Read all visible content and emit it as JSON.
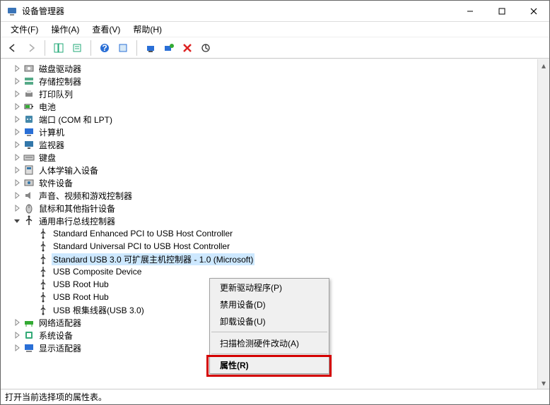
{
  "window": {
    "title": "设备管理器"
  },
  "menu": {
    "file": "文件(F)",
    "action": "操作(A)",
    "view": "查看(V)",
    "help": "帮助(H)"
  },
  "tree": {
    "nodes": [
      {
        "icon": "disk-drive-icon",
        "label": "磁盘驱动器"
      },
      {
        "icon": "storage-ctrl-icon",
        "label": "存储控制器"
      },
      {
        "icon": "print-queue-icon",
        "label": "打印队列"
      },
      {
        "icon": "battery-icon",
        "label": "电池"
      },
      {
        "icon": "ports-icon",
        "label": "端口 (COM 和 LPT)"
      },
      {
        "icon": "computer-icon",
        "label": "计算机"
      },
      {
        "icon": "monitor-icon",
        "label": "监视器"
      },
      {
        "icon": "keyboard-icon",
        "label": "键盘"
      },
      {
        "icon": "hid-icon",
        "label": "人体学输入设备"
      },
      {
        "icon": "software-dev-icon",
        "label": "软件设备"
      },
      {
        "icon": "sound-icon",
        "label": "声音、视频和游戏控制器"
      },
      {
        "icon": "mouse-icon",
        "label": "鼠标和其他指针设备"
      },
      {
        "icon": "usb-ctrl-icon",
        "label": "通用串行总线控制器",
        "expanded": true,
        "children": [
          {
            "label": "Standard Enhanced PCI to USB Host Controller"
          },
          {
            "label": "Standard Universal PCI to USB Host Controller"
          },
          {
            "label": "Standard USB 3.0 可扩展主机控制器 - 1.0 (Microsoft)",
            "selected": true
          },
          {
            "label": "USB Composite Device"
          },
          {
            "label": "USB Root Hub"
          },
          {
            "label": "USB Root Hub"
          },
          {
            "label": "USB 根集线器(USB 3.0)"
          }
        ]
      },
      {
        "icon": "network-icon",
        "label": "网络适配器"
      },
      {
        "icon": "system-dev-icon",
        "label": "系统设备"
      },
      {
        "icon": "display-icon",
        "label": "显示适配器"
      }
    ]
  },
  "context_menu": {
    "items": [
      {
        "label": "更新驱动程序(P)"
      },
      {
        "label": "禁用设备(D)"
      },
      {
        "label": "卸载设备(U)"
      },
      {
        "sep": true
      },
      {
        "label": "扫描检测硬件改动(A)"
      },
      {
        "sep": true
      },
      {
        "label": "属性(R)",
        "highlight": true
      }
    ]
  },
  "statusbar": {
    "text": "打开当前选择项的属性表。"
  }
}
